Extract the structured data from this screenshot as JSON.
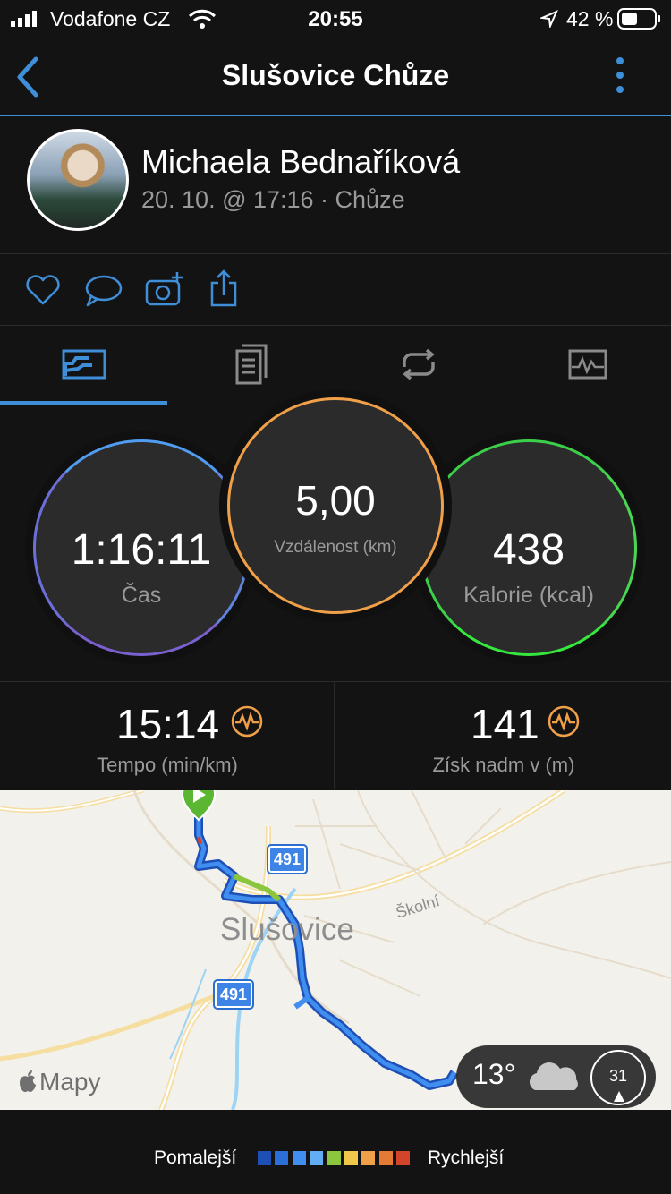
{
  "status_bar": {
    "carrier": "Vodafone CZ",
    "time": "20:55",
    "battery_pct": "42 %"
  },
  "header": {
    "title": "Slušovice Chůze"
  },
  "activity": {
    "user_name": "Michaela Bednaříková",
    "meta": "20. 10. @ 17:16 · Chůze"
  },
  "actions": [
    "heart-icon",
    "comment-icon",
    "add-photo-icon",
    "share-icon"
  ],
  "tabs": [
    {
      "icon": "stats-icon",
      "selected": true
    },
    {
      "icon": "details-icon",
      "selected": false
    },
    {
      "icon": "laps-icon",
      "selected": false
    },
    {
      "icon": "chart-icon",
      "selected": false
    }
  ],
  "stats": {
    "time": {
      "value": "1:16:11",
      "label": "Čas"
    },
    "distance": {
      "value": "5,00",
      "label": "Vzdálenost (km)"
    },
    "calories": {
      "value": "438",
      "label": "Kalorie (kcal)"
    }
  },
  "metrics": {
    "pace": {
      "value": "15:14",
      "label": "Tempo (min/km)"
    },
    "elevation": {
      "value": "141",
      "label": "Získ nadm v (m)"
    }
  },
  "map": {
    "town_label": "Slušovice",
    "street_label": "Školní",
    "road_numbers": [
      "491",
      "491"
    ],
    "attribution": "Mapy",
    "weather": {
      "temperature": "13°",
      "wind": "31"
    }
  },
  "legend": {
    "slower": "Pomalejší",
    "faster": "Rychlejší",
    "colors": [
      "#1e4fb5",
      "#2d6fd8",
      "#3f8ef0",
      "#62aef5",
      "#8cc63e",
      "#f0c74a",
      "#f0a048",
      "#e57a34",
      "#d2452b"
    ]
  },
  "colors": {
    "accent": "#3e8ed8",
    "time_ring": "#6d6fd8",
    "distance_ring": "#f0a048",
    "calorie_ring": "#3ccf4a"
  }
}
